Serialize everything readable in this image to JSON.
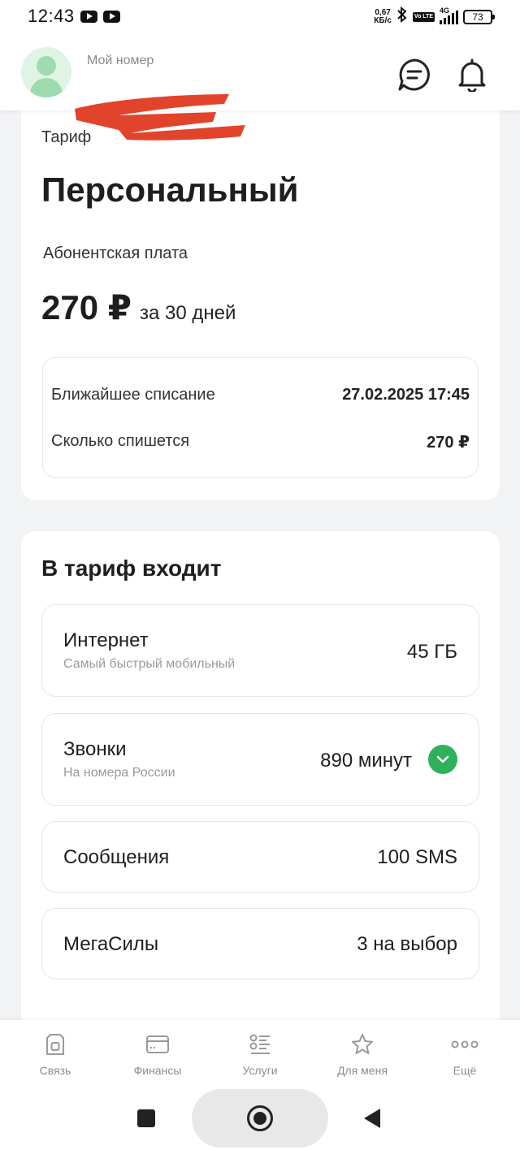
{
  "status_bar": {
    "time": "12:43",
    "net_speed_value": "0,67",
    "net_speed_unit": "КБ/с",
    "network_type": "4G",
    "volte": "Vo LTE",
    "battery": "73"
  },
  "header": {
    "my_number_label": "Мой номер"
  },
  "tariff_card": {
    "section_label": "Тариф",
    "name": "Персональный",
    "fee_label": "Абонентская плата",
    "price": "270 ₽",
    "period": "за 30 дней",
    "next_charge_label": "Ближайшее списание",
    "next_charge_value": "27.02.2025 17:45",
    "amount_label": "Сколько спишется",
    "amount_value": "270 ₽"
  },
  "includes_card": {
    "title": "В тариф входит",
    "packages": [
      {
        "title": "Интернет",
        "subtitle": "Самый быстрый мобильный",
        "value": "45 ГБ"
      },
      {
        "title": "Звонки",
        "subtitle": "На номера России",
        "value": "890 минут"
      },
      {
        "title": "Сообщения",
        "subtitle": "",
        "value": "100 SMS"
      },
      {
        "title": "МегаСилы",
        "subtitle": "",
        "value": "3 на выбор"
      }
    ]
  },
  "bottom_nav": {
    "items": [
      {
        "label": "Связь",
        "icon": "sim-icon"
      },
      {
        "label": "Финансы",
        "icon": "card-icon"
      },
      {
        "label": "Услуги",
        "icon": "list-icon"
      },
      {
        "label": "Для меня",
        "icon": "star-icon"
      },
      {
        "label": "Ещё",
        "icon": "more-icon"
      }
    ]
  },
  "colors": {
    "accent_green": "#2fb05a",
    "redaction_red": "#e2442b",
    "background": "#f2f3f5"
  }
}
